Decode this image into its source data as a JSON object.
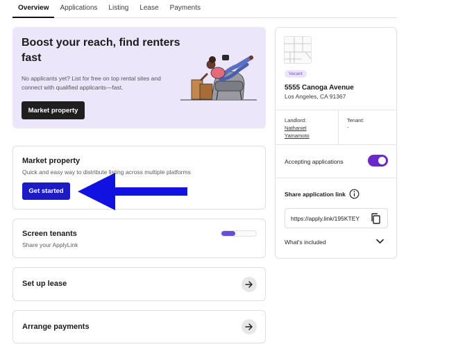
{
  "tabs": [
    {
      "label": "Overview",
      "active": true
    },
    {
      "label": "Applications",
      "active": false
    },
    {
      "label": "Listing",
      "active": false
    },
    {
      "label": "Lease",
      "active": false
    },
    {
      "label": "Payments",
      "active": false
    }
  ],
  "hero": {
    "title": "Boost your reach, find renters fast",
    "description": "No applicants yet? List for free on top rental sites and connect with qualified applicants—fast.",
    "button_label": "Market property"
  },
  "market_card": {
    "title": "Market property",
    "subtitle": "Quick and easy way to distribute listing across multiple platforms",
    "button_label": "Get started"
  },
  "screen_card": {
    "title": "Screen tenants",
    "subtitle": "Share your ApplyLink",
    "progress": 0.4
  },
  "lease_card": {
    "title": "Set up lease"
  },
  "payments_card": {
    "title": "Arrange payments"
  },
  "property": {
    "status": "Vacant",
    "address_line1": "5555 Canoga Avenue",
    "address_line2": "Los Angeles, CA 91367",
    "landlord_label": "Landlord:",
    "landlord_name": "Nathaniel Yamamoto",
    "tenant_label": "Tenant:",
    "tenant_value": "-",
    "accepting_label": "Accepting applications",
    "accepting_on": true,
    "share_label": "Share application link",
    "link_value": "https://apply.link/195KTEY",
    "whats_included": "What's included"
  },
  "colors": {
    "accent_purple": "#6a27c9",
    "button_blue": "#1c1cc6",
    "annotation_arrow": "#1212e0",
    "hero_bg": "#ebe6fa"
  },
  "icons": {
    "info": "info-circle-icon",
    "copy": "copy-icon",
    "chevron": "chevron-down-icon",
    "arrow": "arrow-right-icon"
  }
}
